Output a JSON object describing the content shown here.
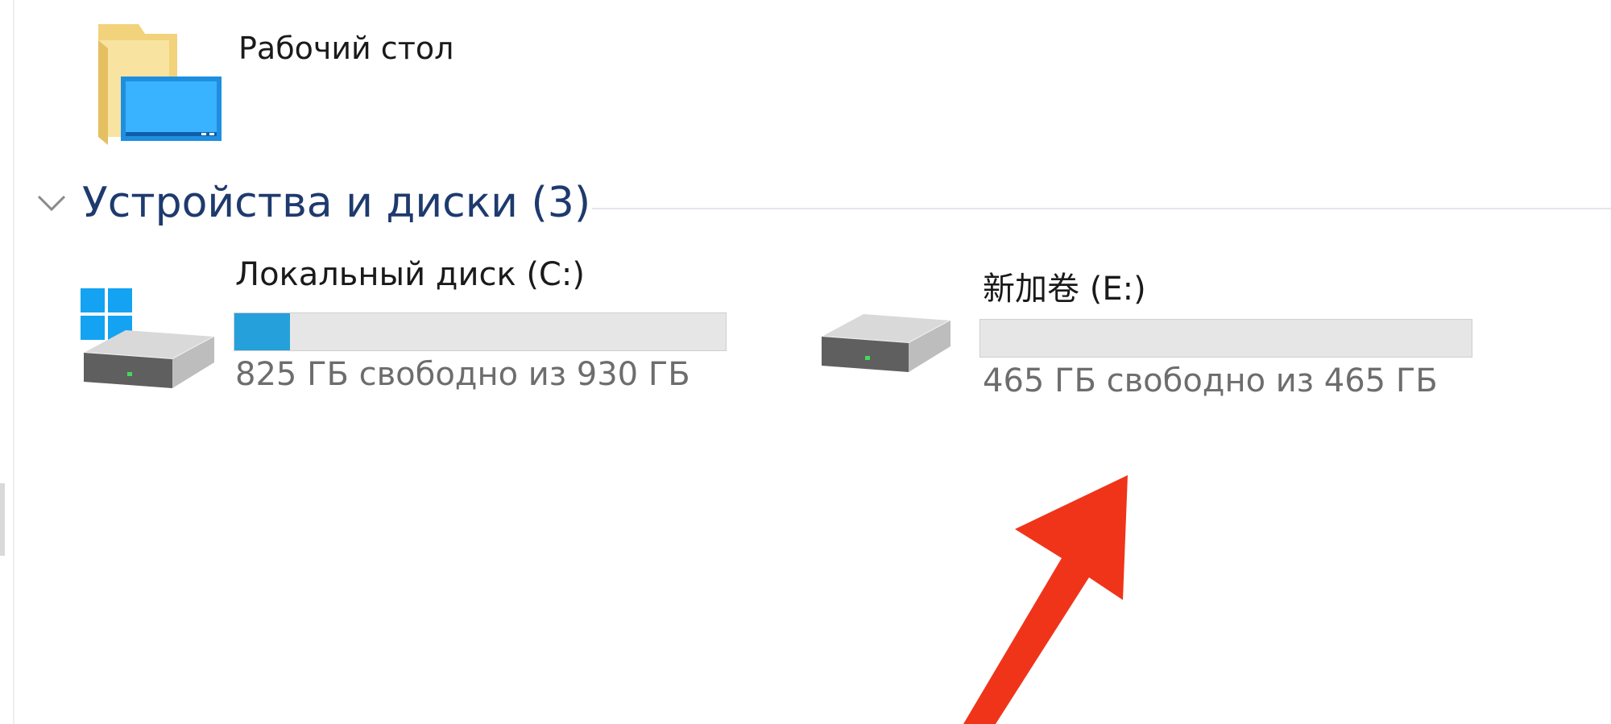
{
  "desktop": {
    "label": "Рабочий стол",
    "icon": "desktop-folder-icon"
  },
  "devices_group": {
    "title": "Устройства и диски (3)",
    "collapse_icon": "chevron-down-icon"
  },
  "drives": [
    {
      "name": "Локальный диск (C:)",
      "free_text": "825 ГБ свободно из 930 ГБ",
      "used_fraction": 0.113,
      "bar_color": "#26a0da",
      "icon": "windows-system-drive-icon"
    },
    {
      "name": "新加卷 (E:)",
      "free_text": "465 ГБ свободно из 465 ГБ",
      "used_fraction": 0,
      "bar_color": "#26a0da",
      "icon": "hard-drive-icon"
    }
  ],
  "annotation": {
    "icon": "red-arrow-icon",
    "color": "#f0341a"
  },
  "colors": {
    "group_title": "#1e3a6e",
    "secondary_text": "#6d6d6d",
    "bar_track": "#e6e6e6"
  }
}
